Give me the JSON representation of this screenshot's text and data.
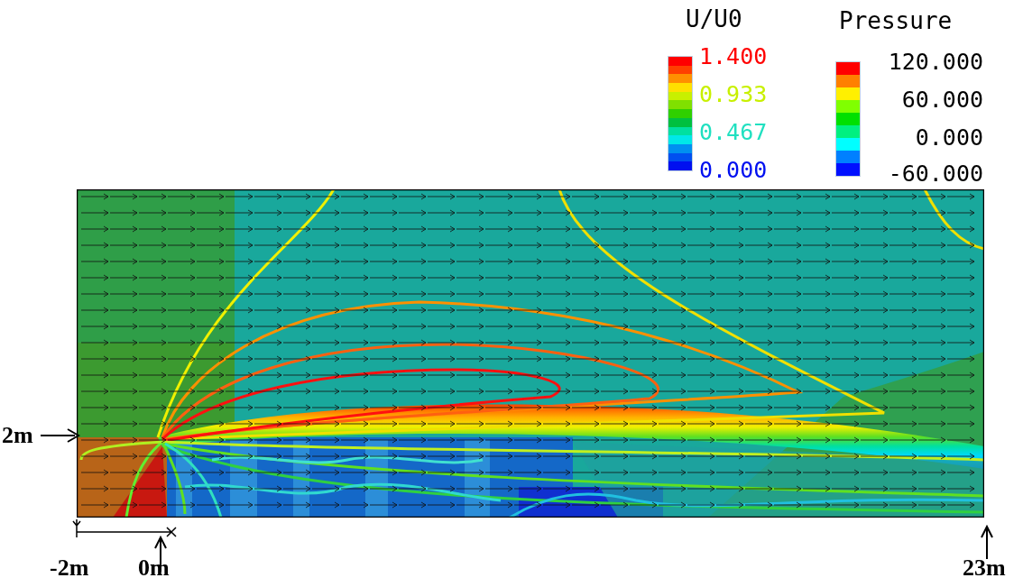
{
  "legends": [
    {
      "title": "U/U0",
      "swatches": [
        {
          "color": "#ff0000"
        },
        {
          "color": "#ff4000"
        },
        {
          "color": "#ff9000"
        },
        {
          "color": "#ffe000"
        },
        {
          "color": "#c8f000"
        },
        {
          "color": "#80e000"
        },
        {
          "color": "#30d000"
        },
        {
          "color": "#00c040"
        },
        {
          "color": "#00e0a0"
        },
        {
          "color": "#00e8e8"
        },
        {
          "color": "#0090f0"
        },
        {
          "color": "#0050f0"
        },
        {
          "color": "#0010f0"
        }
      ],
      "labels": [
        {
          "text": "1.400",
          "color": "#ff0000"
        },
        {
          "text": "0.933",
          "color": "#c8f000"
        },
        {
          "text": "0.467",
          "color": "#20e0c0"
        },
        {
          "text": "0.000",
          "color": "#0010f0"
        }
      ]
    },
    {
      "title": "Pressure",
      "swatches": [
        {
          "color": "#ff0000"
        },
        {
          "color": "#ff8000"
        },
        {
          "color": "#fff000"
        },
        {
          "color": "#80ff00"
        },
        {
          "color": "#00e000"
        },
        {
          "color": "#00f080"
        },
        {
          "color": "#00ffff"
        },
        {
          "color": "#0080ff"
        },
        {
          "color": "#0010ff"
        }
      ],
      "labels": [
        {
          "text": "120.000",
          "color": "#000000"
        },
        {
          "text": "60.000",
          "color": "#000000"
        },
        {
          "text": "0.000",
          "color": "#000000"
        },
        {
          "text": "-60.000",
          "color": "#000000"
        }
      ]
    }
  ],
  "markers": [
    {
      "kind": "left",
      "text": "2m"
    },
    {
      "kind": "below",
      "text": "-2m"
    },
    {
      "kind": "up",
      "text": "0m"
    },
    {
      "kind": "up-right",
      "text": "23m"
    }
  ]
}
